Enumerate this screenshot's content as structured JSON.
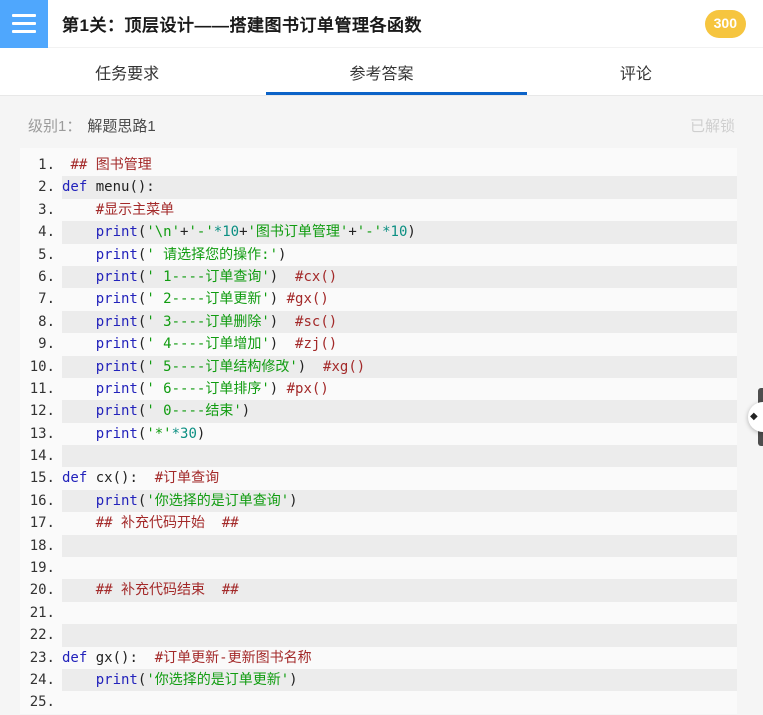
{
  "header": {
    "title": "第1关：顶层设计——搭建图书订单管理各函数",
    "badge": "300"
  },
  "tabs": [
    {
      "label": "任务要求",
      "active": false
    },
    {
      "label": "参考答案",
      "active": true
    },
    {
      "label": "评论",
      "active": false
    }
  ],
  "level_bar": {
    "level_label": "级别1：",
    "title": "解题思路1",
    "status": "已解锁"
  },
  "colors": {
    "accent_blue": "#4fa7fd",
    "tab_underline": "#0c63c8",
    "badge_yellow": "#f6c53f",
    "code_even_row": "#ececec",
    "keyword": "#2222bb",
    "string": "#109c10",
    "number": "#0b8f82",
    "comment": "#a32929"
  },
  "code": {
    "language": "python",
    "lines": [
      {
        "tokens": [
          [
            "plain",
            " "
          ],
          [
            "com",
            "## 图书管理"
          ]
        ]
      },
      {
        "tokens": [
          [
            "kw",
            "def"
          ],
          [
            "plain",
            " menu():"
          ]
        ]
      },
      {
        "tokens": [
          [
            "plain",
            "    "
          ],
          [
            "com",
            "#显示主菜单"
          ]
        ]
      },
      {
        "tokens": [
          [
            "plain",
            "    "
          ],
          [
            "kw",
            "print"
          ],
          [
            "plain",
            "("
          ],
          [
            "str",
            "'\\n'"
          ],
          [
            "plain",
            "+"
          ],
          [
            "str",
            "'-'"
          ],
          [
            "num",
            "*10"
          ],
          [
            "plain",
            "+"
          ],
          [
            "str",
            "'图书订单管理'"
          ],
          [
            "plain",
            "+"
          ],
          [
            "str",
            "'-'"
          ],
          [
            "num",
            "*10"
          ],
          [
            "plain",
            ")"
          ]
        ]
      },
      {
        "tokens": [
          [
            "plain",
            "    "
          ],
          [
            "kw",
            "print"
          ],
          [
            "plain",
            "("
          ],
          [
            "str",
            "' 请选择您的操作:'"
          ],
          [
            "plain",
            ")"
          ]
        ]
      },
      {
        "tokens": [
          [
            "plain",
            "    "
          ],
          [
            "kw",
            "print"
          ],
          [
            "plain",
            "("
          ],
          [
            "str",
            "' 1----订单查询'"
          ],
          [
            "plain",
            ")  "
          ],
          [
            "com",
            "#cx()"
          ]
        ]
      },
      {
        "tokens": [
          [
            "plain",
            "    "
          ],
          [
            "kw",
            "print"
          ],
          [
            "plain",
            "("
          ],
          [
            "str",
            "' 2----订单更新'"
          ],
          [
            "plain",
            ") "
          ],
          [
            "com",
            "#gx()"
          ]
        ]
      },
      {
        "tokens": [
          [
            "plain",
            "    "
          ],
          [
            "kw",
            "print"
          ],
          [
            "plain",
            "("
          ],
          [
            "str",
            "' 3----订单删除'"
          ],
          [
            "plain",
            ")  "
          ],
          [
            "com",
            "#sc()"
          ]
        ]
      },
      {
        "tokens": [
          [
            "plain",
            "    "
          ],
          [
            "kw",
            "print"
          ],
          [
            "plain",
            "("
          ],
          [
            "str",
            "' 4----订单增加'"
          ],
          [
            "plain",
            ")  "
          ],
          [
            "com",
            "#zj()"
          ]
        ]
      },
      {
        "tokens": [
          [
            "plain",
            "    "
          ],
          [
            "kw",
            "print"
          ],
          [
            "plain",
            "("
          ],
          [
            "str",
            "' 5----订单结构修改'"
          ],
          [
            "plain",
            ")  "
          ],
          [
            "com",
            "#xg()"
          ]
        ]
      },
      {
        "tokens": [
          [
            "plain",
            "    "
          ],
          [
            "kw",
            "print"
          ],
          [
            "plain",
            "("
          ],
          [
            "str",
            "' 6----订单排序'"
          ],
          [
            "plain",
            ") "
          ],
          [
            "com",
            "#px()"
          ]
        ]
      },
      {
        "tokens": [
          [
            "plain",
            "    "
          ],
          [
            "kw",
            "print"
          ],
          [
            "plain",
            "("
          ],
          [
            "str",
            "' 0----结束'"
          ],
          [
            "plain",
            ")"
          ]
        ]
      },
      {
        "tokens": [
          [
            "plain",
            "    "
          ],
          [
            "kw",
            "print"
          ],
          [
            "plain",
            "("
          ],
          [
            "str",
            "'*'"
          ],
          [
            "num",
            "*30"
          ],
          [
            "plain",
            ")"
          ]
        ]
      },
      {
        "tokens": []
      },
      {
        "tokens": [
          [
            "kw",
            "def"
          ],
          [
            "plain",
            " cx():  "
          ],
          [
            "com",
            "#订单查询"
          ]
        ]
      },
      {
        "tokens": [
          [
            "plain",
            "    "
          ],
          [
            "kw",
            "print"
          ],
          [
            "plain",
            "("
          ],
          [
            "str",
            "'你选择的是订单查询'"
          ],
          [
            "plain",
            ")"
          ]
        ]
      },
      {
        "tokens": [
          [
            "plain",
            "    "
          ],
          [
            "com",
            "## 补充代码开始  ##"
          ]
        ]
      },
      {
        "tokens": []
      },
      {
        "tokens": []
      },
      {
        "tokens": [
          [
            "plain",
            "    "
          ],
          [
            "com",
            "## 补充代码结束  ##"
          ]
        ]
      },
      {
        "tokens": []
      },
      {
        "tokens": []
      },
      {
        "tokens": [
          [
            "kw",
            "def"
          ],
          [
            "plain",
            " gx():  "
          ],
          [
            "com",
            "#订单更新-更新图书名称"
          ]
        ]
      },
      {
        "tokens": [
          [
            "plain",
            "    "
          ],
          [
            "kw",
            "print"
          ],
          [
            "plain",
            "("
          ],
          [
            "str",
            "'你选择的是订单更新'"
          ],
          [
            "plain",
            ")"
          ]
        ]
      },
      {
        "tokens": []
      }
    ]
  }
}
